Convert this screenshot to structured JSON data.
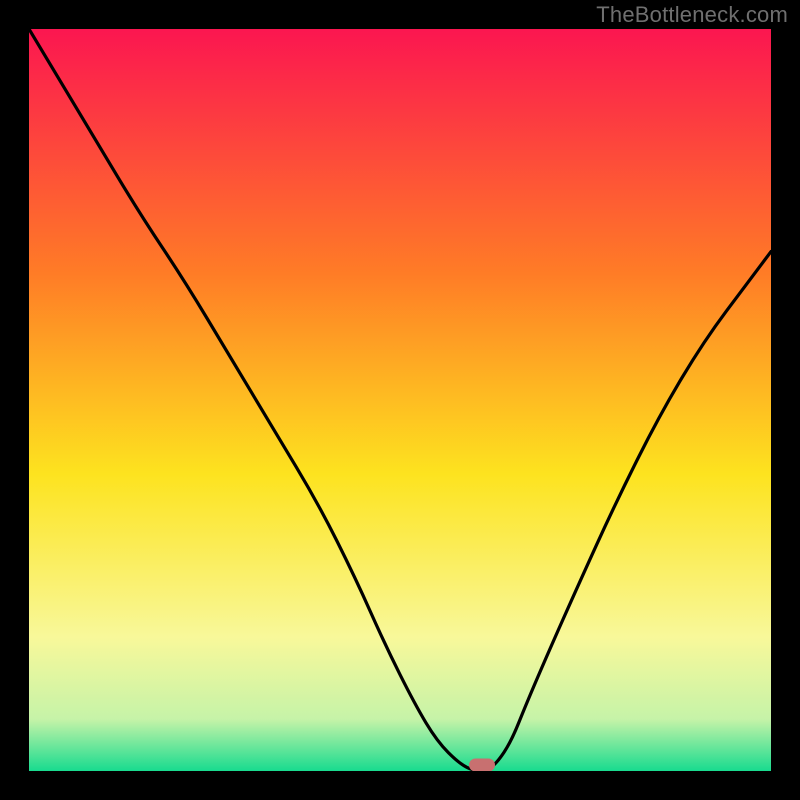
{
  "watermark": "TheBottleneck.com",
  "colors": {
    "top": "#fb1650",
    "mid_upper": "#ff7c26",
    "mid": "#fde31f",
    "mid_lower": "#f8f89a",
    "near_bottom": "#c6f3a8",
    "bottom": "#18db8f",
    "curve": "#000000",
    "marker": "#c87070",
    "frame": "#000000"
  },
  "chart_data": {
    "type": "line",
    "title": "",
    "xlabel": "",
    "ylabel": "",
    "xlim": [
      0,
      100
    ],
    "ylim": [
      0,
      100
    ],
    "series": [
      {
        "name": "bottleneck-curve",
        "x": [
          0,
          3,
          9,
          15,
          21,
          27,
          33,
          39,
          44,
          48,
          52,
          55,
          58,
          60,
          61.5,
          63,
          65,
          67,
          70,
          74,
          79,
          85,
          91,
          97,
          100
        ],
        "y": [
          100,
          95,
          85,
          75,
          66,
          56,
          46,
          36,
          26,
          17,
          9,
          4,
          1,
          0,
          0,
          1,
          4,
          9,
          16,
          25,
          36,
          48,
          58,
          66,
          70
        ]
      }
    ],
    "annotations": [
      {
        "name": "optimal-marker",
        "x": 61,
        "y": 0.8
      }
    ],
    "gradient_stops": [
      {
        "pos": 0.0,
        "color": "#fb1650"
      },
      {
        "pos": 0.33,
        "color": "#ff7c26"
      },
      {
        "pos": 0.6,
        "color": "#fde31f"
      },
      {
        "pos": 0.82,
        "color": "#f8f89a"
      },
      {
        "pos": 0.93,
        "color": "#c6f3a8"
      },
      {
        "pos": 1.0,
        "color": "#18db8f"
      }
    ]
  }
}
